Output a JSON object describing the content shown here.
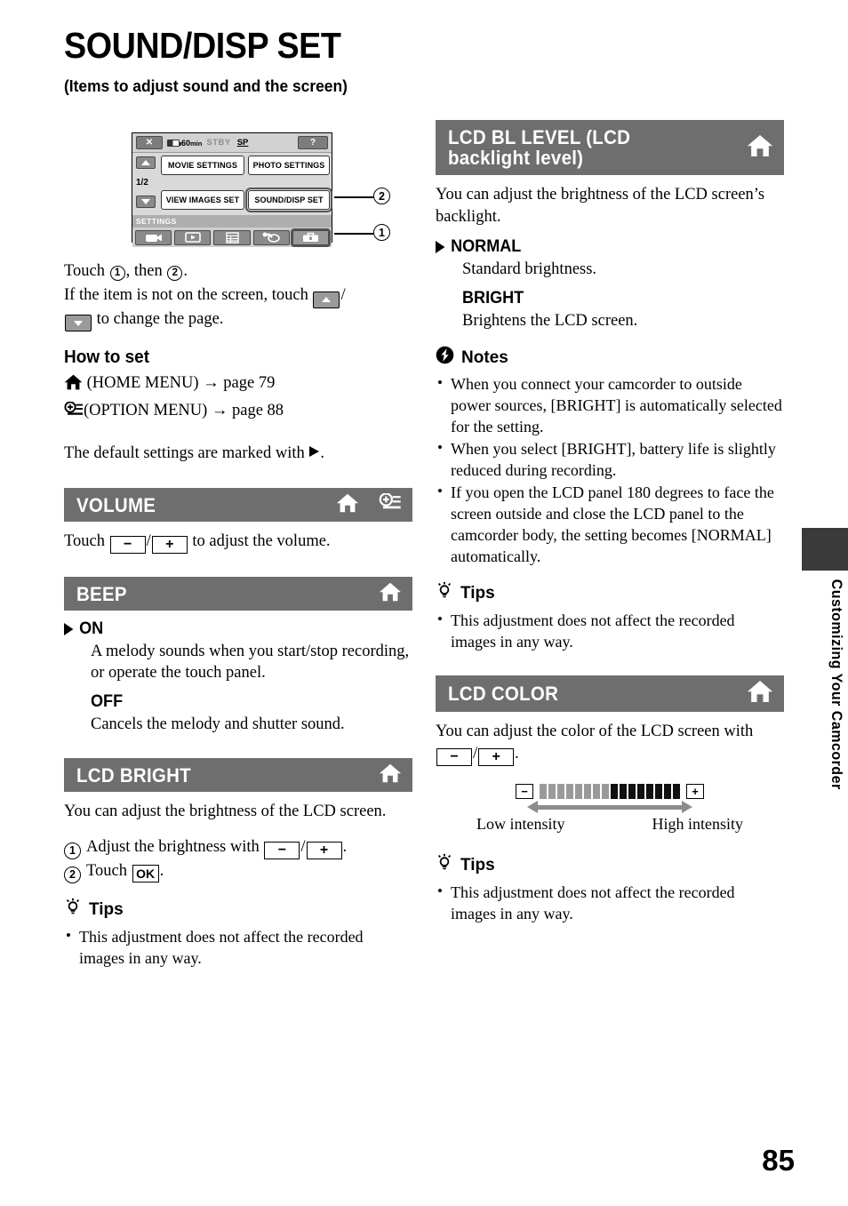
{
  "page": {
    "title": "SOUND/DISP SET",
    "subtitle": "(Items to adjust sound and the screen)",
    "number": "85",
    "edge_tab": "Customizing Your Camcorder"
  },
  "figure": {
    "status_bar": {
      "close_label": "✕",
      "battery_time": "60",
      "battery_unit": "min",
      "mode": "STBY",
      "quality": "SP",
      "help_label": "?"
    },
    "page_indicator": "1/2",
    "menu_buttons": [
      "MOVIE SETTINGS",
      "PHOTO SETTINGS",
      "VIEW IMAGES SET",
      "SOUND/DISP SET"
    ],
    "settings_label": "SETTINGS",
    "tabs": [
      "camera-tab-icon",
      "playback-tab-icon",
      "manage-media-tab-icon",
      "others-tab-icon",
      "settings-tab-icon"
    ],
    "callout_1": "1",
    "callout_2": "2"
  },
  "intro": {
    "line1_pre": "Touch ",
    "line1_num1": "1",
    "line1_mid": ", then ",
    "line1_num2": "2",
    "line1_end": ".",
    "line2_pre": "If the item is not on the screen, touch ",
    "line2_sep": "/",
    "line2_end": " to change the page."
  },
  "how_to_set": {
    "heading": "How to set",
    "home_label": "(HOME MENU)",
    "home_arrow": "→",
    "home_page": "page 79",
    "option_label": "(OPTION MENU)",
    "option_arrow": "→",
    "option_page": "page 88",
    "default_note_pre": "The default settings are marked with ",
    "default_note_end": "."
  },
  "sections": {
    "volume": {
      "title": "VOLUME",
      "icons": [
        "home-icon",
        "option-menu-icon"
      ],
      "body_pre": "Touch ",
      "key_minus": "−",
      "body_sep": "/",
      "key_plus": "+",
      "body_end": " to adjust the volume."
    },
    "beep": {
      "title": "BEEP",
      "icons": [
        "home-icon"
      ],
      "options": [
        {
          "name": "ON",
          "default": true,
          "desc": "A melody sounds when you start/stop recording, or operate the touch panel."
        },
        {
          "name": "OFF",
          "default": false,
          "desc": "Cancels the melody and shutter sound."
        }
      ]
    },
    "lcd_bright": {
      "title": "LCD BRIGHT",
      "icons": [
        "home-icon"
      ],
      "intro": "You can adjust the brightness of the LCD screen.",
      "step1_pre": "Adjust the brightness with ",
      "step1_minus": "−",
      "step1_sep": "/",
      "step1_plus": "+",
      "step1_end": ".",
      "step2_pre": "Touch ",
      "step2_key": "OK",
      "step2_end": ".",
      "step1_num": "1",
      "step2_num": "2",
      "tips_heading": "Tips",
      "tips": [
        "This adjustment does not affect the recorded images in any way."
      ]
    },
    "lcd_bl_level": {
      "title_line1": "LCD BL LEVEL (LCD",
      "title_line2": "backlight level)",
      "icons": [
        "home-icon"
      ],
      "intro": "You can adjust the brightness of the LCD screen’s backlight.",
      "options": [
        {
          "name": "NORMAL",
          "default": true,
          "desc": "Standard brightness."
        },
        {
          "name": "BRIGHT",
          "default": false,
          "desc": "Brightens the LCD screen."
        }
      ],
      "notes_heading": "Notes",
      "notes": [
        "When you connect your camcorder to outside power sources, [BRIGHT] is automatically selected for the setting.",
        "When you select [BRIGHT], battery life is slightly reduced during recording.",
        "If you open the LCD panel 180 degrees to face the screen outside and close the LCD panel to the camcorder body, the setting becomes [NORMAL] automatically."
      ],
      "tips_heading": "Tips",
      "tips": [
        "This adjustment does not affect the recorded images in any way."
      ]
    },
    "lcd_color": {
      "title": "LCD COLOR",
      "icons": [
        "home-icon"
      ],
      "intro_pre": "You can adjust the color of the LCD screen with ",
      "key_minus": "−",
      "intro_sep": "/",
      "key_plus": "+",
      "intro_end": ".",
      "scale": {
        "minus_label": "−",
        "plus_label": "+",
        "low_label": "Low intensity",
        "high_label": "High intensity",
        "segments_low": 8,
        "segments_high": 8
      },
      "tips_heading": "Tips",
      "tips": [
        "This adjustment does not affect the recorded images in any way."
      ]
    }
  },
  "colors": {
    "section_bar": "#6e6e6e",
    "edge_tab_block": "#3a3a3a",
    "lcd_body": "#d9d9d9",
    "lcd_statusbar": "#d2d2d2"
  }
}
